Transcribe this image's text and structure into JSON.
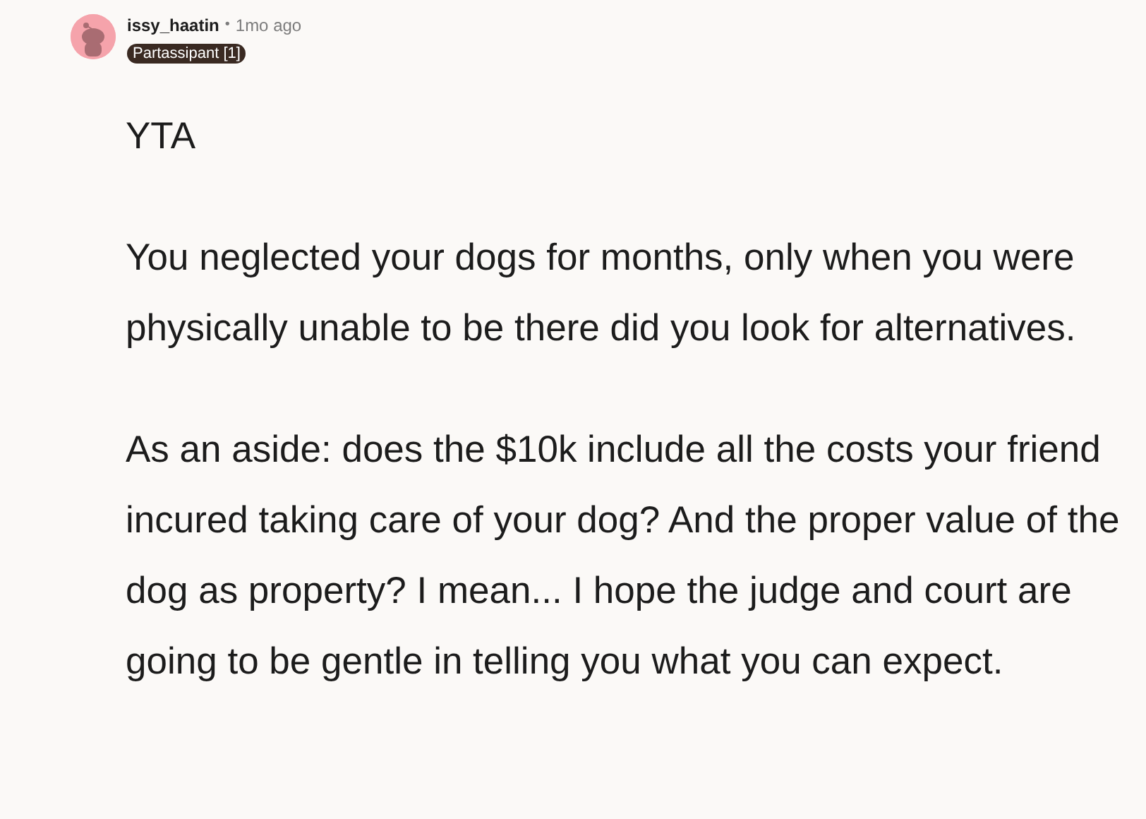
{
  "comment": {
    "author": "issy_haatin",
    "separator": "•",
    "time": "1mo ago",
    "flair": "Partassipant [1]",
    "paragraphs": [
      "YTA",
      "You neglected your dogs for months, only when you were physically unable to be there did you look for alternatives.",
      "As an aside: does the $10k include all the costs your friend incured taking care of your dog? And the proper value of the dog as property? I mean... I hope the judge and court are going to be gentle in telling you what you can expect."
    ]
  }
}
